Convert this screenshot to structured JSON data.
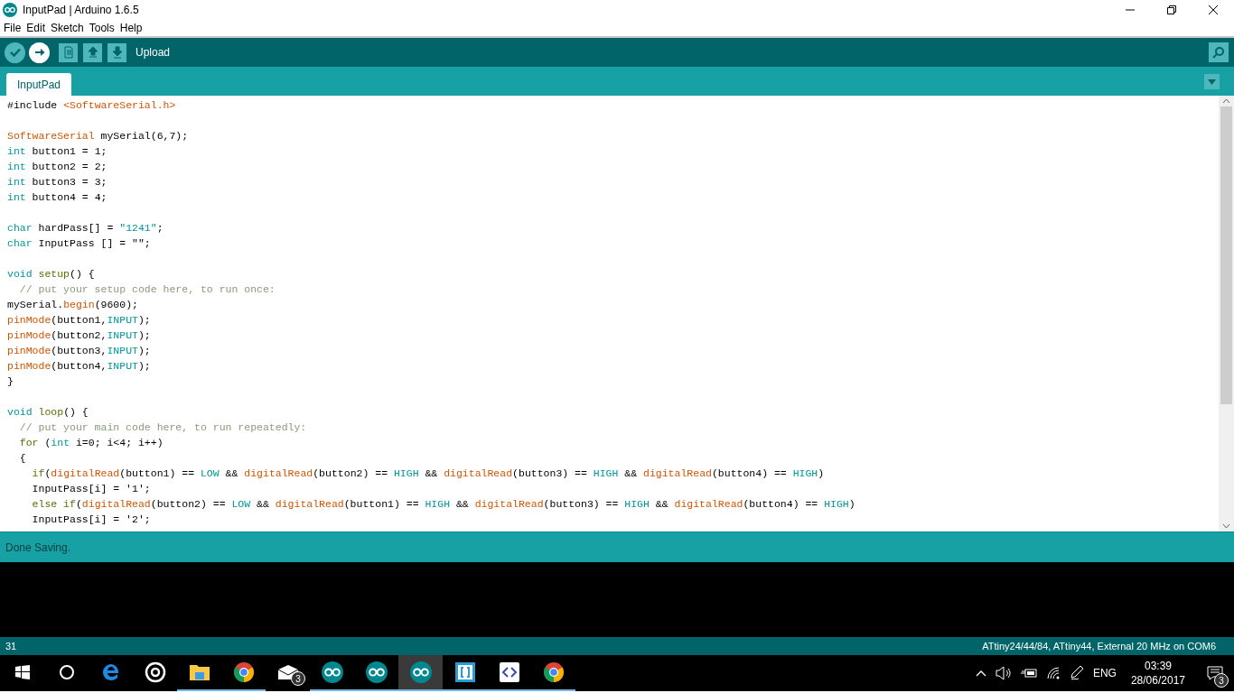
{
  "window": {
    "title": "InputPad | Arduino 1.6.5"
  },
  "menu": [
    "File",
    "Edit",
    "Sketch",
    "Tools",
    "Help"
  ],
  "toolbar": {
    "buttons": [
      {
        "kind": "verify",
        "selected": false
      },
      {
        "kind": "upload",
        "selected": true
      },
      {
        "kind": "new",
        "selected": false
      },
      {
        "kind": "open",
        "selected": false
      },
      {
        "kind": "save",
        "selected": false
      }
    ],
    "hover_label": "Upload"
  },
  "tabs": [
    {
      "label": "InputPad",
      "selected": true
    }
  ],
  "editor": {
    "lines": [
      {
        "kind": "code",
        "tokens": [
          {
            "kind": "plain",
            "t": "#include "
          },
          {
            "kind": "fn",
            "t": "<SoftwareSerial.h>"
          }
        ]
      },
      {
        "kind": "blank"
      },
      {
        "kind": "code",
        "tokens": [
          {
            "kind": "fn",
            "t": "SoftwareSerial"
          },
          {
            "kind": "plain",
            "t": " mySerial(6,7);"
          }
        ]
      },
      {
        "kind": "code",
        "tokens": [
          {
            "kind": "type",
            "t": "int"
          },
          {
            "kind": "plain",
            "t": " button1 = 1;"
          }
        ]
      },
      {
        "kind": "code",
        "tokens": [
          {
            "kind": "type",
            "t": "int"
          },
          {
            "kind": "plain",
            "t": " button2 = 2;"
          }
        ]
      },
      {
        "kind": "code",
        "tokens": [
          {
            "kind": "type",
            "t": "int"
          },
          {
            "kind": "plain",
            "t": " button3 = 3;"
          }
        ]
      },
      {
        "kind": "code",
        "tokens": [
          {
            "kind": "type",
            "t": "int"
          },
          {
            "kind": "plain",
            "t": " button4 = 4;"
          }
        ]
      },
      {
        "kind": "blank"
      },
      {
        "kind": "code",
        "tokens": [
          {
            "kind": "type",
            "t": "char"
          },
          {
            "kind": "plain",
            "t": " hardPass[] = "
          },
          {
            "kind": "string",
            "t": "\"1241\""
          },
          {
            "kind": "plain",
            "t": ";"
          }
        ]
      },
      {
        "kind": "code",
        "tokens": [
          {
            "kind": "type",
            "t": "char"
          },
          {
            "kind": "plain",
            "t": " InputPass [] = \"\";"
          }
        ]
      },
      {
        "kind": "blank"
      },
      {
        "kind": "code",
        "tokens": [
          {
            "kind": "type",
            "t": "void "
          },
          {
            "kind": "ctrl",
            "t": "setup"
          },
          {
            "kind": "plain",
            "t": "() {"
          }
        ]
      },
      {
        "kind": "code",
        "tokens": [
          {
            "kind": "comment",
            "t": "  // put your setup code here, to run once:"
          }
        ]
      },
      {
        "kind": "code",
        "tokens": [
          {
            "kind": "plain",
            "t": "mySerial."
          },
          {
            "kind": "fn",
            "t": "begin"
          },
          {
            "kind": "plain",
            "t": "(9600);"
          }
        ]
      },
      {
        "kind": "code",
        "tokens": [
          {
            "kind": "fn",
            "t": "pinMode"
          },
          {
            "kind": "plain",
            "t": "(button1,"
          },
          {
            "kind": "const",
            "t": "INPUT"
          },
          {
            "kind": "plain",
            "t": ");"
          }
        ]
      },
      {
        "kind": "code",
        "tokens": [
          {
            "kind": "fn",
            "t": "pinMode"
          },
          {
            "kind": "plain",
            "t": "(button2,"
          },
          {
            "kind": "const",
            "t": "INPUT"
          },
          {
            "kind": "plain",
            "t": ");"
          }
        ]
      },
      {
        "kind": "code",
        "tokens": [
          {
            "kind": "fn",
            "t": "pinMode"
          },
          {
            "kind": "plain",
            "t": "(button3,"
          },
          {
            "kind": "const",
            "t": "INPUT"
          },
          {
            "kind": "plain",
            "t": ");"
          }
        ]
      },
      {
        "kind": "code",
        "tokens": [
          {
            "kind": "fn",
            "t": "pinMode"
          },
          {
            "kind": "plain",
            "t": "(button4,"
          },
          {
            "kind": "const",
            "t": "INPUT"
          },
          {
            "kind": "plain",
            "t": ");"
          }
        ]
      },
      {
        "kind": "code",
        "tokens": [
          {
            "kind": "plain",
            "t": "}"
          }
        ]
      },
      {
        "kind": "blank"
      },
      {
        "kind": "code",
        "tokens": [
          {
            "kind": "type",
            "t": "void "
          },
          {
            "kind": "ctrl",
            "t": "loop"
          },
          {
            "kind": "plain",
            "t": "() {"
          }
        ]
      },
      {
        "kind": "code",
        "tokens": [
          {
            "kind": "comment",
            "t": "  // put your main code here, to run repeatedly:"
          }
        ]
      },
      {
        "kind": "code",
        "tokens": [
          {
            "kind": "ctrl",
            "t": "  for"
          },
          {
            "kind": "plain",
            "t": " ("
          },
          {
            "kind": "type",
            "t": "int"
          },
          {
            "kind": "plain",
            "t": " i=0; i<4; i++)"
          }
        ]
      },
      {
        "kind": "code",
        "tokens": [
          {
            "kind": "plain",
            "t": "  {"
          }
        ]
      },
      {
        "kind": "code",
        "tokens": [
          {
            "kind": "ctrl",
            "t": "    if"
          },
          {
            "kind": "plain",
            "t": "("
          },
          {
            "kind": "fn",
            "t": "digitalRead"
          },
          {
            "kind": "plain",
            "t": "(button1) == "
          },
          {
            "kind": "const",
            "t": "LOW"
          },
          {
            "kind": "plain",
            "t": " && "
          },
          {
            "kind": "fn",
            "t": "digitalRead"
          },
          {
            "kind": "plain",
            "t": "(button2) == "
          },
          {
            "kind": "const",
            "t": "HIGH"
          },
          {
            "kind": "plain",
            "t": " && "
          },
          {
            "kind": "fn",
            "t": "digitalRead"
          },
          {
            "kind": "plain",
            "t": "(button3) == "
          },
          {
            "kind": "const",
            "t": "HIGH"
          },
          {
            "kind": "plain",
            "t": " && "
          },
          {
            "kind": "fn",
            "t": "digitalRead"
          },
          {
            "kind": "plain",
            "t": "(button4) == "
          },
          {
            "kind": "const",
            "t": "HIGH"
          },
          {
            "kind": "plain",
            "t": ")"
          }
        ]
      },
      {
        "kind": "code",
        "tokens": [
          {
            "kind": "plain",
            "t": "    InputPass[i] = '1';"
          }
        ]
      },
      {
        "kind": "code",
        "tokens": [
          {
            "kind": "ctrl",
            "t": "    else if"
          },
          {
            "kind": "plain",
            "t": "("
          },
          {
            "kind": "fn",
            "t": "digitalRead"
          },
          {
            "kind": "plain",
            "t": "(button2) == "
          },
          {
            "kind": "const",
            "t": "LOW"
          },
          {
            "kind": "plain",
            "t": " && "
          },
          {
            "kind": "fn",
            "t": "digitalRead"
          },
          {
            "kind": "plain",
            "t": "(button1) == "
          },
          {
            "kind": "const",
            "t": "HIGH"
          },
          {
            "kind": "plain",
            "t": " && "
          },
          {
            "kind": "fn",
            "t": "digitalRead"
          },
          {
            "kind": "plain",
            "t": "(button3) == "
          },
          {
            "kind": "const",
            "t": "HIGH"
          },
          {
            "kind": "plain",
            "t": " && "
          },
          {
            "kind": "fn",
            "t": "digitalRead"
          },
          {
            "kind": "plain",
            "t": "(button4) == "
          },
          {
            "kind": "const",
            "t": "HIGH"
          },
          {
            "kind": "plain",
            "t": ")"
          }
        ]
      },
      {
        "kind": "code",
        "tokens": [
          {
            "kind": "plain",
            "t": "    InputPass[i] = '2';"
          }
        ]
      }
    ]
  },
  "message_bar": "Done Saving.",
  "status_bar": {
    "line": "31",
    "board": "ATtiny24/44/84, ATtiny44, External 20 MHz on COM6"
  },
  "taskbar": {
    "apps": [
      {
        "kind": "start",
        "open": false,
        "selected": false
      },
      {
        "kind": "search",
        "open": false,
        "selected": false
      },
      {
        "kind": "edge",
        "open": false,
        "selected": false
      },
      {
        "kind": "groove",
        "open": false,
        "selected": false
      },
      {
        "kind": "folder",
        "open": true,
        "selected": false
      },
      {
        "kind": "chrome",
        "open": true,
        "selected": false
      },
      {
        "kind": "mail",
        "open": false,
        "selected": false,
        "badge": "3"
      },
      {
        "kind": "arduino",
        "open": true,
        "selected": false
      },
      {
        "kind": "arduino",
        "open": true,
        "selected": false
      },
      {
        "kind": "arduino",
        "open": true,
        "selected": true
      },
      {
        "kind": "brackets",
        "open": true,
        "selected": false
      },
      {
        "kind": "code",
        "open": true,
        "selected": false
      },
      {
        "kind": "chrome",
        "open": true,
        "selected": false
      }
    ],
    "language": "ENG",
    "time": "03:39",
    "date": "28/06/2017",
    "notifications": "3"
  }
}
